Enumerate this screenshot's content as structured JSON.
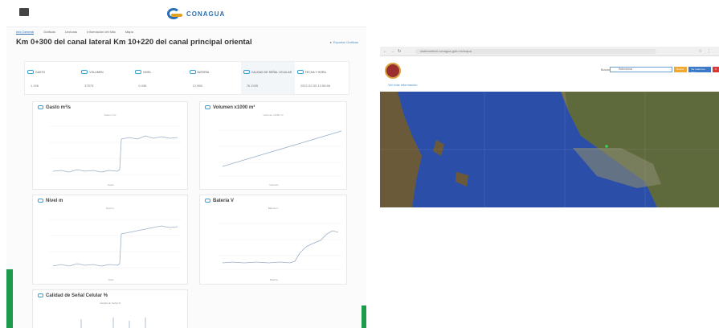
{
  "dashboard": {
    "tabs": [
      "Info General",
      "Gráficas",
      "Lecturas",
      "Información del sitio",
      "Mapa"
    ],
    "title": "Km 0+300 del canal lateral Km 10+220 del canal principal oriental",
    "export_label": "Exportar Gráficas",
    "logo_text": "CONAGUA",
    "stats": [
      {
        "label": "GASTO",
        "value": "1.196"
      },
      {
        "label": "VOLUMEN",
        "value": "37575"
      },
      {
        "label": "NIVEL",
        "value": "0.436"
      },
      {
        "label": "BATERÍA",
        "value": "12.958"
      },
      {
        "label": "CALIDAD DE SEÑAL CELULAR",
        "value": "76.1935"
      },
      {
        "label": "FECHA Y HORA",
        "value": "2022-02-05 12:56:56"
      }
    ],
    "cards": [
      {
        "title": "Gasto m³/s",
        "subtitle": "Gasto m³/s",
        "legend": "Gasto"
      },
      {
        "title": "Volumen x1000 m³",
        "subtitle": "Volumen x1000 m³",
        "legend": "Volumen"
      },
      {
        "title": "Nivel m",
        "subtitle": "Nivel m",
        "legend": "Nivel"
      },
      {
        "title": "Batería V",
        "subtitle": "Batería V",
        "legend": "Batería"
      },
      {
        "title": "Calidad de Señal Celular %",
        "subtitle": "Calidad de Señal %"
      }
    ]
  },
  "map_app": {
    "url": "sistemafmcli.conagua.gob.mx/mapa",
    "select_label": "Buscar",
    "select_value": "Selecciona",
    "buttons": [
      "Buscar",
      "Ver todos los sitios",
      "X"
    ],
    "sublink": "Ver más información"
  },
  "colors": {
    "accent": "#2a6fb3",
    "water": "#2a4fa8",
    "land": "#6a6a48",
    "series": "#9ab0c8",
    "green": "#1e9b4a"
  }
}
